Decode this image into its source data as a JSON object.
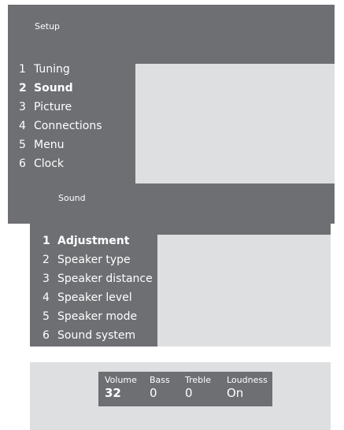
{
  "setup_menu": {
    "title": "Setup",
    "items": [
      {
        "number": "1",
        "label": "Tuning"
      },
      {
        "number": "2",
        "label": "Sound",
        "selected": true
      },
      {
        "number": "3",
        "label": "Picture"
      },
      {
        "number": "4",
        "label": "Connections"
      },
      {
        "number": "5",
        "label": "Menu"
      },
      {
        "number": "6",
        "label": "Clock"
      }
    ]
  },
  "sound_menu": {
    "title": "Sound",
    "items": [
      {
        "number": "1",
        "label": "Adjustment",
        "selected": true
      },
      {
        "number": "2",
        "label": "Speaker type"
      },
      {
        "number": "3",
        "label": "Speaker distance"
      },
      {
        "number": "4",
        "label": "Speaker level"
      },
      {
        "number": "5",
        "label": "Speaker mode"
      },
      {
        "number": "6",
        "label": "Sound system"
      }
    ]
  },
  "sound_status": {
    "volume": {
      "label": "Volume",
      "value": "32"
    },
    "bass": {
      "label": "Bass",
      "value": "0"
    },
    "treble": {
      "label": "Treble",
      "value": "0"
    },
    "loudness": {
      "label": "Loudness",
      "value": "On"
    }
  },
  "colors": {
    "panel": "#6e6f73",
    "panel_light": "#dedfe0",
    "text": "#ffffff"
  }
}
